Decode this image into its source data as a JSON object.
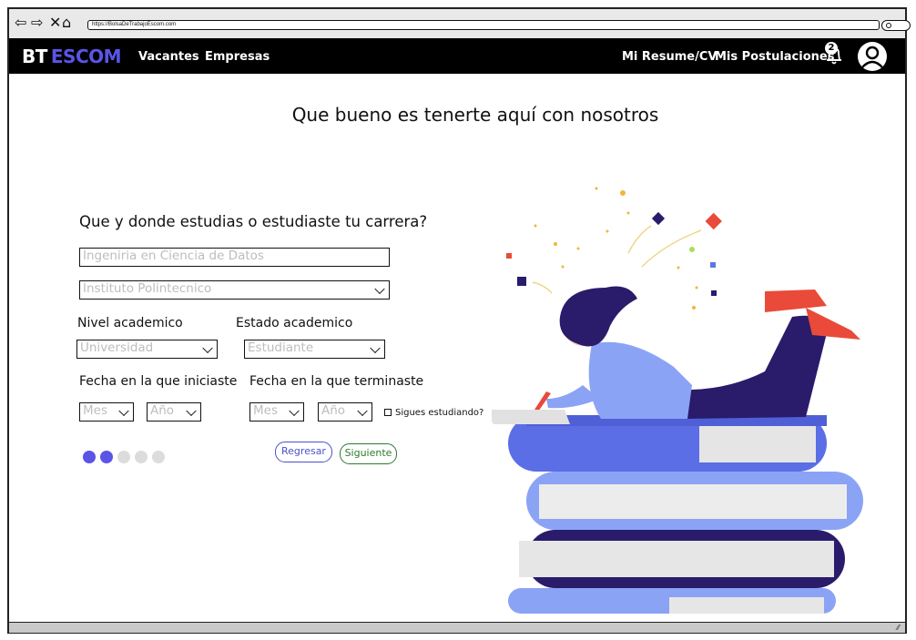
{
  "browser": {
    "url": "https://BolsaDeTrabajoEscom.com",
    "back_icon": "arrow-left-icon",
    "forward_icon": "arrow-right-icon",
    "close_icon": "close-icon",
    "home_icon": "home-icon"
  },
  "navbar": {
    "brand_bt": "BT",
    "brand_escom": "ESCOM",
    "links": [
      "Vacantes",
      "Empresas"
    ],
    "resume_link": "Mi Resume/CV",
    "applications_link": "Mis Postulaciones",
    "notification_count": "2",
    "brand_color": "#5b54e6"
  },
  "page": {
    "heading": "Que bueno es tenerte aquí con nosotros",
    "question": "Que y donde estudias o estudiaste tu carrera?"
  },
  "form": {
    "career_placeholder": "Ingeniria en Ciencia de Datos",
    "school_placeholder": "Instituto Polintecnico",
    "academic_level_label": "Nivel academico",
    "academic_level_value": "Universidad",
    "academic_status_label": "Estado academico",
    "academic_status_value": "Estudiante",
    "start_date_label": "Fecha en la que iniciaste",
    "end_date_label": "Fecha en la que terminaste",
    "month_placeholder": "Mes",
    "year_placeholder": "Año",
    "still_studying_label": "Sigues estudiando?"
  },
  "progress": {
    "total_steps": 5,
    "current_step": 2,
    "active_color": "#5b54e6",
    "inactive_color": "#dcdcdc"
  },
  "actions": {
    "back_label": "Regresar",
    "next_label": "Siguiente"
  }
}
